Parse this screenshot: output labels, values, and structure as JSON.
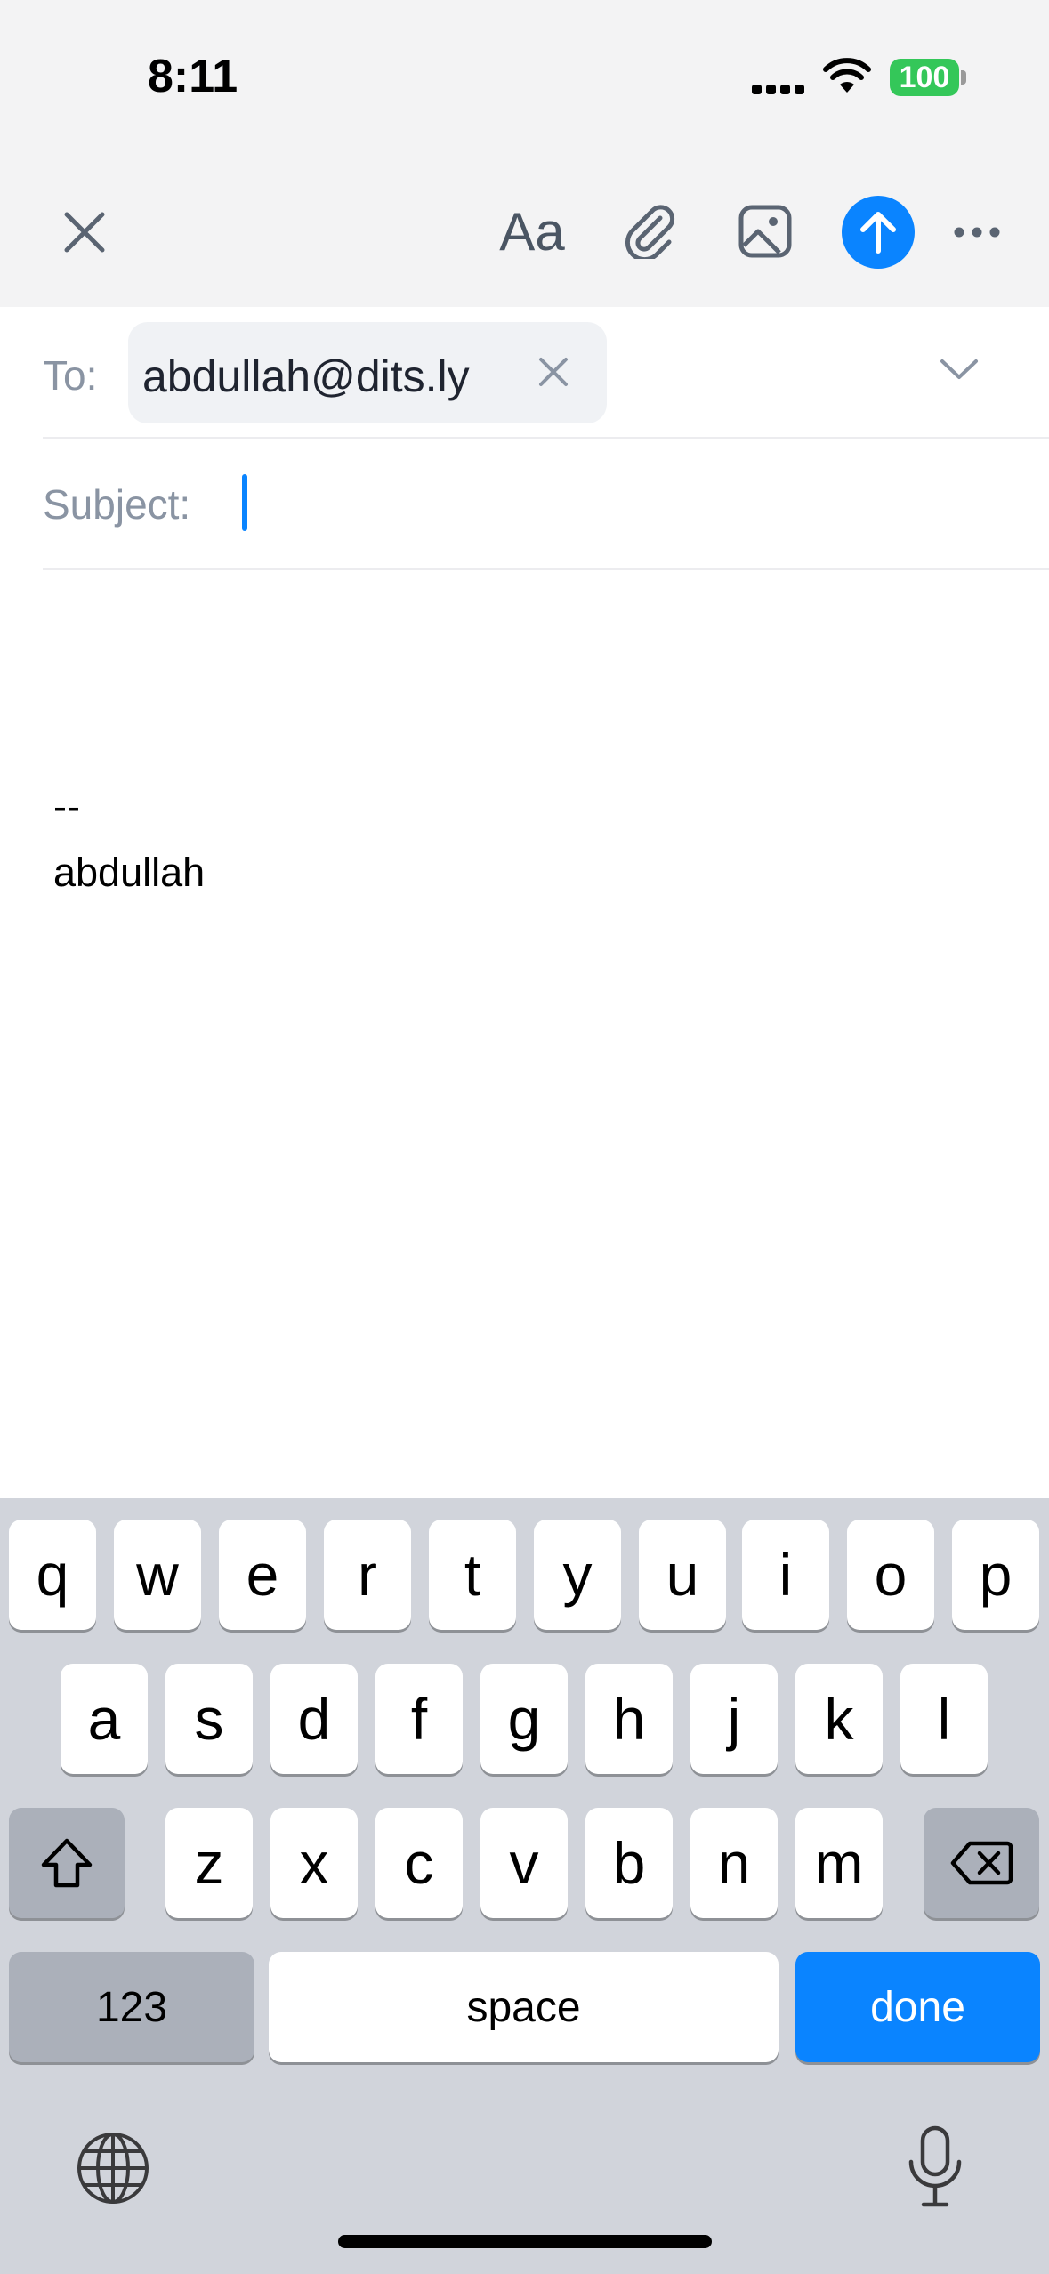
{
  "status": {
    "time": "8:11",
    "battery": "100"
  },
  "toolbar": {
    "font_label": "Aa"
  },
  "to": {
    "label": "To:",
    "recipient": "abdullah@dits.ly"
  },
  "subject": {
    "label": "Subject:",
    "value": ""
  },
  "body": {
    "signature_dash": "--",
    "signature_name": "abdullah"
  },
  "keyboard": {
    "row1": [
      "q",
      "w",
      "e",
      "r",
      "t",
      "y",
      "u",
      "i",
      "o",
      "p"
    ],
    "row2": [
      "a",
      "s",
      "d",
      "f",
      "g",
      "h",
      "j",
      "k",
      "l"
    ],
    "row3": [
      "z",
      "x",
      "c",
      "v",
      "b",
      "n",
      "m"
    ],
    "numbers": "123",
    "space": "space",
    "done": "done"
  },
  "colors": {
    "accent": "#0a84ff",
    "battery": "#34c759"
  }
}
